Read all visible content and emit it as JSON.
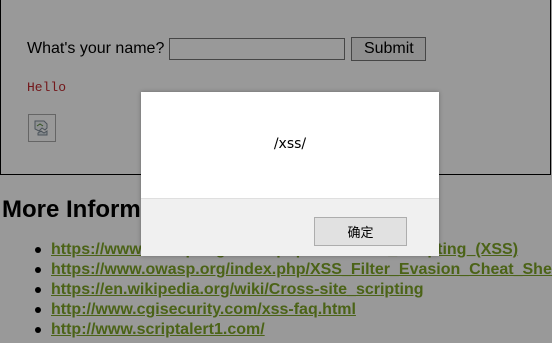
{
  "form": {
    "label": "What's your name?",
    "input_value": "",
    "submit_label": "Submit"
  },
  "output": {
    "hello_text": "Hello"
  },
  "section": {
    "heading": "More Information"
  },
  "links": [
    "https://www.owasp.org/index.php/Cross-site_Scripting_(XSS)",
    "https://www.owasp.org/index.php/XSS_Filter_Evasion_Cheat_Sheet",
    "https://en.wikipedia.org/wiki/Cross-site_scripting",
    "http://www.cgisecurity.com/xss-faq.html",
    "http://www.scriptalert1.com/"
  ],
  "dialog": {
    "message": "/xss/",
    "ok_label": "确定"
  },
  "colors": {
    "link": "#7ea527",
    "hello": "#c0282d",
    "overlay": "rgba(0,0,0,0.40)"
  },
  "icons": {
    "broken_image": "broken-image-icon"
  }
}
